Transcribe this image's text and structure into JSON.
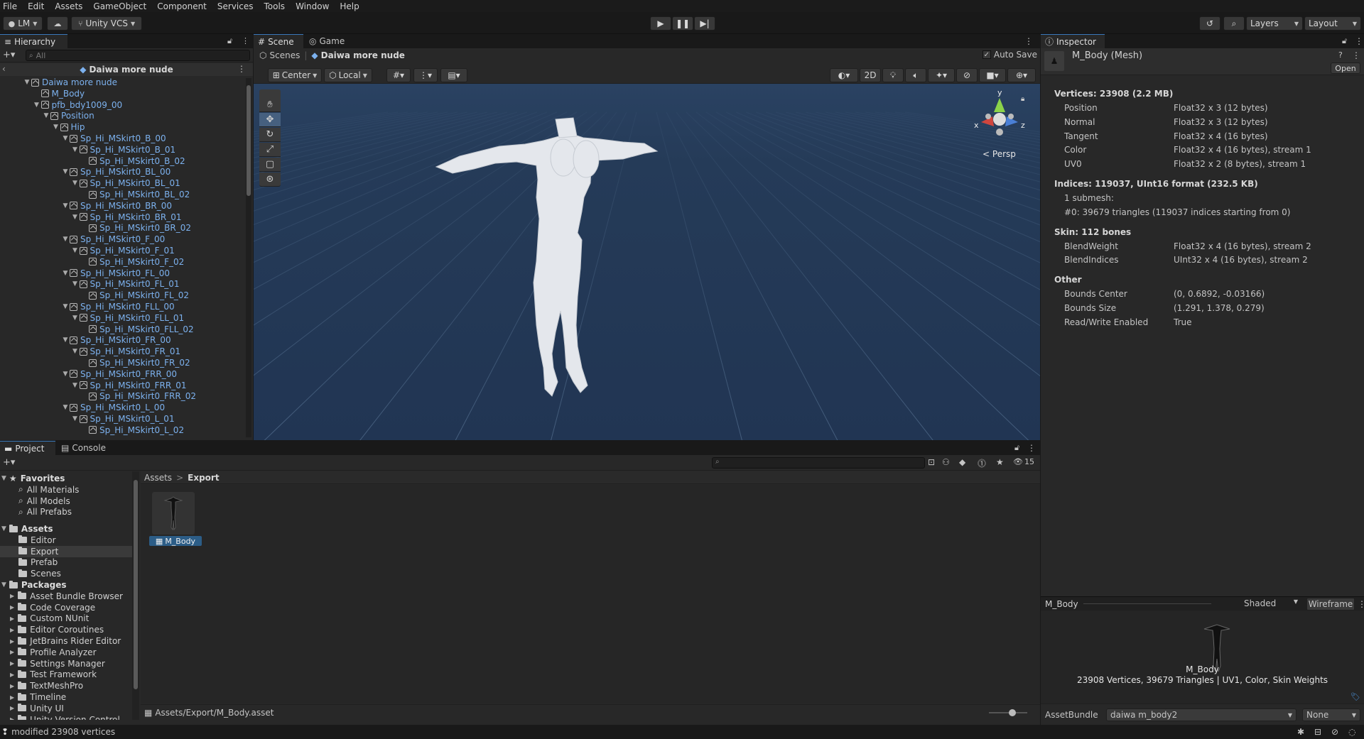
{
  "menu": [
    "File",
    "Edit",
    "Assets",
    "GameObject",
    "Component",
    "Services",
    "Tools",
    "Window",
    "Help"
  ],
  "toolbar": {
    "account": "LM",
    "vcs": "Unity VCS",
    "layers": "Layers",
    "layout": "Layout"
  },
  "hierarchy": {
    "tab": "Hierarchy",
    "search_placeholder": "All",
    "scene": "Daiwa more nude",
    "items": [
      {
        "label": "Daiwa more nude",
        "depth": 0,
        "arrow": "▼"
      },
      {
        "label": "M_Body",
        "depth": 1,
        "arrow": ""
      },
      {
        "label": "pfb_bdy1009_00",
        "depth": 1,
        "arrow": "▼"
      },
      {
        "label": "Position",
        "depth": 2,
        "arrow": "▼"
      },
      {
        "label": "Hip",
        "depth": 3,
        "arrow": "▼"
      },
      {
        "label": "Sp_Hi_MSkirt0_B_00",
        "depth": 4,
        "arrow": "▼"
      },
      {
        "label": "Sp_Hi_MSkirt0_B_01",
        "depth": 5,
        "arrow": "▼"
      },
      {
        "label": "Sp_Hi_MSkirt0_B_02",
        "depth": 6,
        "arrow": ""
      },
      {
        "label": "Sp_Hi_MSkirt0_BL_00",
        "depth": 4,
        "arrow": "▼"
      },
      {
        "label": "Sp_Hi_MSkirt0_BL_01",
        "depth": 5,
        "arrow": "▼"
      },
      {
        "label": "Sp_Hi_MSkirt0_BL_02",
        "depth": 6,
        "arrow": ""
      },
      {
        "label": "Sp_Hi_MSkirt0_BR_00",
        "depth": 4,
        "arrow": "▼"
      },
      {
        "label": "Sp_Hi_MSkirt0_BR_01",
        "depth": 5,
        "arrow": "▼"
      },
      {
        "label": "Sp_Hi_MSkirt0_BR_02",
        "depth": 6,
        "arrow": ""
      },
      {
        "label": "Sp_Hi_MSkirt0_F_00",
        "depth": 4,
        "arrow": "▼"
      },
      {
        "label": "Sp_Hi_MSkirt0_F_01",
        "depth": 5,
        "arrow": "▼"
      },
      {
        "label": "Sp_Hi_MSkirt0_F_02",
        "depth": 6,
        "arrow": ""
      },
      {
        "label": "Sp_Hi_MSkirt0_FL_00",
        "depth": 4,
        "arrow": "▼"
      },
      {
        "label": "Sp_Hi_MSkirt0_FL_01",
        "depth": 5,
        "arrow": "▼"
      },
      {
        "label": "Sp_Hi_MSkirt0_FL_02",
        "depth": 6,
        "arrow": ""
      },
      {
        "label": "Sp_Hi_MSkirt0_FLL_00",
        "depth": 4,
        "arrow": "▼"
      },
      {
        "label": "Sp_Hi_MSkirt0_FLL_01",
        "depth": 5,
        "arrow": "▼"
      },
      {
        "label": "Sp_Hi_MSkirt0_FLL_02",
        "depth": 6,
        "arrow": ""
      },
      {
        "label": "Sp_Hi_MSkirt0_FR_00",
        "depth": 4,
        "arrow": "▼"
      },
      {
        "label": "Sp_Hi_MSkirt0_FR_01",
        "depth": 5,
        "arrow": "▼"
      },
      {
        "label": "Sp_Hi_MSkirt0_FR_02",
        "depth": 6,
        "arrow": ""
      },
      {
        "label": "Sp_Hi_MSkirt0_FRR_00",
        "depth": 4,
        "arrow": "▼"
      },
      {
        "label": "Sp_Hi_MSkirt0_FRR_01",
        "depth": 5,
        "arrow": "▼"
      },
      {
        "label": "Sp_Hi_MSkirt0_FRR_02",
        "depth": 6,
        "arrow": ""
      },
      {
        "label": "Sp_Hi_MSkirt0_L_00",
        "depth": 4,
        "arrow": "▼"
      },
      {
        "label": "Sp_Hi_MSkirt0_L_01",
        "depth": 5,
        "arrow": "▼"
      },
      {
        "label": "Sp_Hi_MSkirt0_L_02",
        "depth": 6,
        "arrow": ""
      }
    ]
  },
  "scene": {
    "tab_scene": "Scene",
    "tab_game": "Game",
    "breadcrumb_root": "Scenes",
    "breadcrumb_scene": "Daiwa more nude",
    "auto_save": "Auto Save",
    "pivot": "Center",
    "space": "Local",
    "mode_2d": "2D",
    "persp": "Persp",
    "gizmo_y": "y",
    "gizmo_x": "x",
    "gizmo_z": "z"
  },
  "project": {
    "tab_project": "Project",
    "tab_console": "Console",
    "favorites": "Favorites",
    "fav_items": [
      "All Materials",
      "All Models",
      "All Prefabs"
    ],
    "assets": "Assets",
    "asset_items": [
      "Editor",
      "Export",
      "Prefab",
      "Scenes"
    ],
    "packages": "Packages",
    "package_items": [
      "Asset Bundle Browser",
      "Code Coverage",
      "Custom NUnit",
      "Editor Coroutines",
      "JetBrains Rider Editor",
      "Profile Analyzer",
      "Settings Manager",
      "Test Framework",
      "TextMeshPro",
      "Timeline",
      "Unity UI",
      "Unity Version Control"
    ],
    "breadcrumb": [
      "Assets",
      "Export"
    ],
    "asset_name": "M_Body",
    "path": "Assets/Export/M_Body.asset",
    "hidden_count": "15"
  },
  "inspector": {
    "tab": "Inspector",
    "title": "M_Body (Mesh)",
    "open": "Open",
    "vertices_header": "Vertices: 23908 (2.2 MB)",
    "vertex_attrs": [
      [
        "Position",
        "Float32 x 3 (12 bytes)"
      ],
      [
        "Normal",
        "Float32 x 3 (12 bytes)"
      ],
      [
        "Tangent",
        "Float32 x 4 (16 bytes)"
      ],
      [
        "Color",
        "Float32 x 4 (16 bytes), stream 1"
      ],
      [
        "UV0",
        "Float32 x 2 (8 bytes), stream 1"
      ]
    ],
    "indices_header": "Indices: 119037, UInt16 format (232.5 KB)",
    "submesh_count": "1 submesh:",
    "submesh_detail": "#0: 39679 triangles (119037 indices starting from 0)",
    "skin_header": "Skin: 112 bones",
    "skin_attrs": [
      [
        "BlendWeight",
        "Float32 x 4 (16 bytes), stream 2"
      ],
      [
        "BlendIndices",
        "UInt32 x 4 (16 bytes), stream 2"
      ]
    ],
    "other_header": "Other",
    "other_attrs": [
      [
        "Bounds Center",
        "(0, 0.6892, -0.03166)"
      ],
      [
        "Bounds Size",
        "(1.291, 1.378, 0.279)"
      ],
      [
        "Read/Write Enabled",
        "True"
      ]
    ],
    "preview_name": "M_Body",
    "preview_mode": "Shaded",
    "preview_wireframe": "Wireframe",
    "preview_label": "M_Body",
    "preview_stats": "23908 Vertices, 39679 Triangles | UV1, Color, Skin Weights",
    "assetbundle_label": "AssetBundle",
    "assetbundle_value": "daiwa m_body2",
    "assetbundle_variant": "None"
  },
  "status": {
    "message": "modified 23908 vertices"
  }
}
